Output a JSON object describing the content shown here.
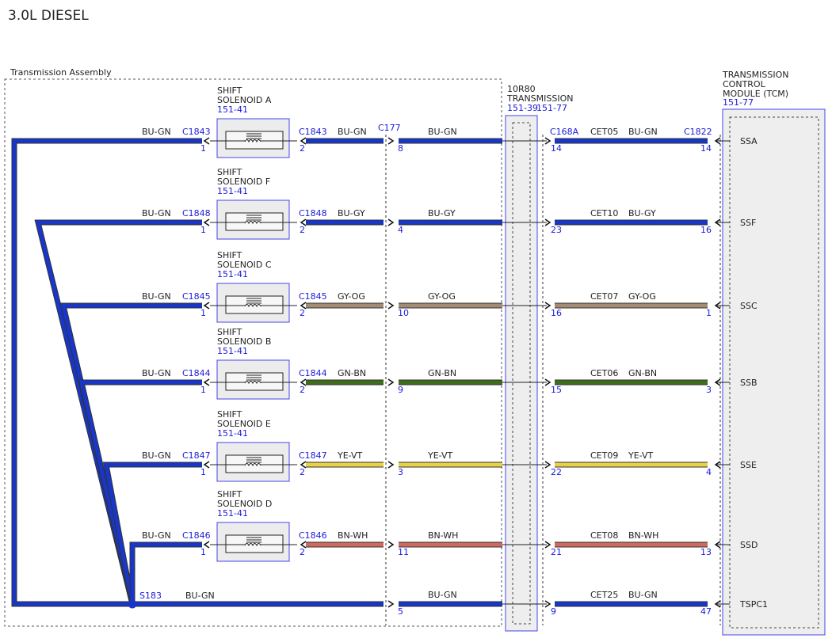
{
  "page_title": "3.0L DIESEL",
  "assembly_label": "Transmission Assembly",
  "transmission_box": {
    "line1": "10R80",
    "line2": "TRANSMISSION",
    "ref1": "151-39",
    "ref2": "151-77"
  },
  "tcm": {
    "line1": "TRANSMISSION",
    "line2": "CONTROL",
    "line3": "MODULE (TCM)",
    "ref": "151-77"
  },
  "splice": {
    "name": "S183",
    "wire": "BU-GN"
  },
  "inline_connector": "C177",
  "left_connector_tcm_side": "C168A",
  "tcm_connector": "C1822",
  "colors": {
    "BU-GN": "#1836c8",
    "BU-GY": "#1836c8",
    "GY-OG": "#a48c74",
    "GN-BN": "#3e6e1c",
    "YE-VT": "#e9d144",
    "BN-WH": "#d06a60"
  },
  "circuits": [
    {
      "solenoid": {
        "l1": "SHIFT",
        "l2": "SOLENOID A",
        "ref": "151-41"
      },
      "sol_conn": "C1843",
      "ret_wire": "BU-GN",
      "ret_pin": "1",
      "sig_pin": "2",
      "sig_wire": "BU-GN",
      "c177_pin": "8",
      "mid_wire": "BU-GN",
      "c168_pin": "14",
      "cet": "CET05",
      "r_wire": "BU-GN",
      "tcm_pin": "14",
      "signal": "SSA",
      "color": "BU-GN"
    },
    {
      "solenoid": {
        "l1": "SHIFT",
        "l2": "SOLENOID F",
        "ref": "151-41"
      },
      "sol_conn": "C1848",
      "ret_wire": "BU-GN",
      "ret_pin": "1",
      "sig_pin": "2",
      "sig_wire": "BU-GY",
      "c177_pin": "4",
      "mid_wire": "BU-GY",
      "c168_pin": "23",
      "cet": "CET10",
      "r_wire": "BU-GY",
      "tcm_pin": "16",
      "signal": "SSF",
      "color": "BU-GY"
    },
    {
      "solenoid": {
        "l1": "SHIFT",
        "l2": "SOLENOID C",
        "ref": "151-41"
      },
      "sol_conn": "C1845",
      "ret_wire": "BU-GN",
      "ret_pin": "1",
      "sig_pin": "2",
      "sig_wire": "GY-OG",
      "c177_pin": "10",
      "mid_wire": "GY-OG",
      "c168_pin": "16",
      "cet": "CET07",
      "r_wire": "GY-OG",
      "tcm_pin": "1",
      "signal": "SSC",
      "color": "GY-OG"
    },
    {
      "solenoid": {
        "l1": "SHIFT",
        "l2": "SOLENOID B",
        "ref": "151-41"
      },
      "sol_conn": "C1844",
      "ret_wire": "BU-GN",
      "ret_pin": "1",
      "sig_pin": "2",
      "sig_wire": "GN-BN",
      "c177_pin": "9",
      "mid_wire": "GN-BN",
      "c168_pin": "15",
      "cet": "CET06",
      "r_wire": "GN-BN",
      "tcm_pin": "3",
      "signal": "SSB",
      "color": "GN-BN"
    },
    {
      "solenoid": {
        "l1": "SHIFT",
        "l2": "SOLENOID E",
        "ref": "151-41"
      },
      "sol_conn": "C1847",
      "ret_wire": "BU-GN",
      "ret_pin": "1",
      "sig_pin": "2",
      "sig_wire": "YE-VT",
      "c177_pin": "3",
      "mid_wire": "YE-VT",
      "c168_pin": "22",
      "cet": "CET09",
      "r_wire": "YE-VT",
      "tcm_pin": "4",
      "signal": "SSE",
      "color": "YE-VT"
    },
    {
      "solenoid": {
        "l1": "SHIFT",
        "l2": "SOLENOID D",
        "ref": "151-41"
      },
      "sol_conn": "C1846",
      "ret_wire": "BU-GN",
      "ret_pin": "1",
      "sig_pin": "2",
      "sig_wire": "BN-WH",
      "c177_pin": "11",
      "mid_wire": "BN-WH",
      "c168_pin": "21",
      "cet": "CET08",
      "r_wire": "BN-WH",
      "tcm_pin": "13",
      "signal": "SSD",
      "color": "BN-WH"
    }
  ],
  "common": {
    "c177_pin": "5",
    "mid_wire": "BU-GN",
    "c168_pin": "9",
    "cet": "CET25",
    "r_wire": "BU-GN",
    "tcm_pin": "47",
    "signal": "TSPC1",
    "color": "BU-GN"
  }
}
